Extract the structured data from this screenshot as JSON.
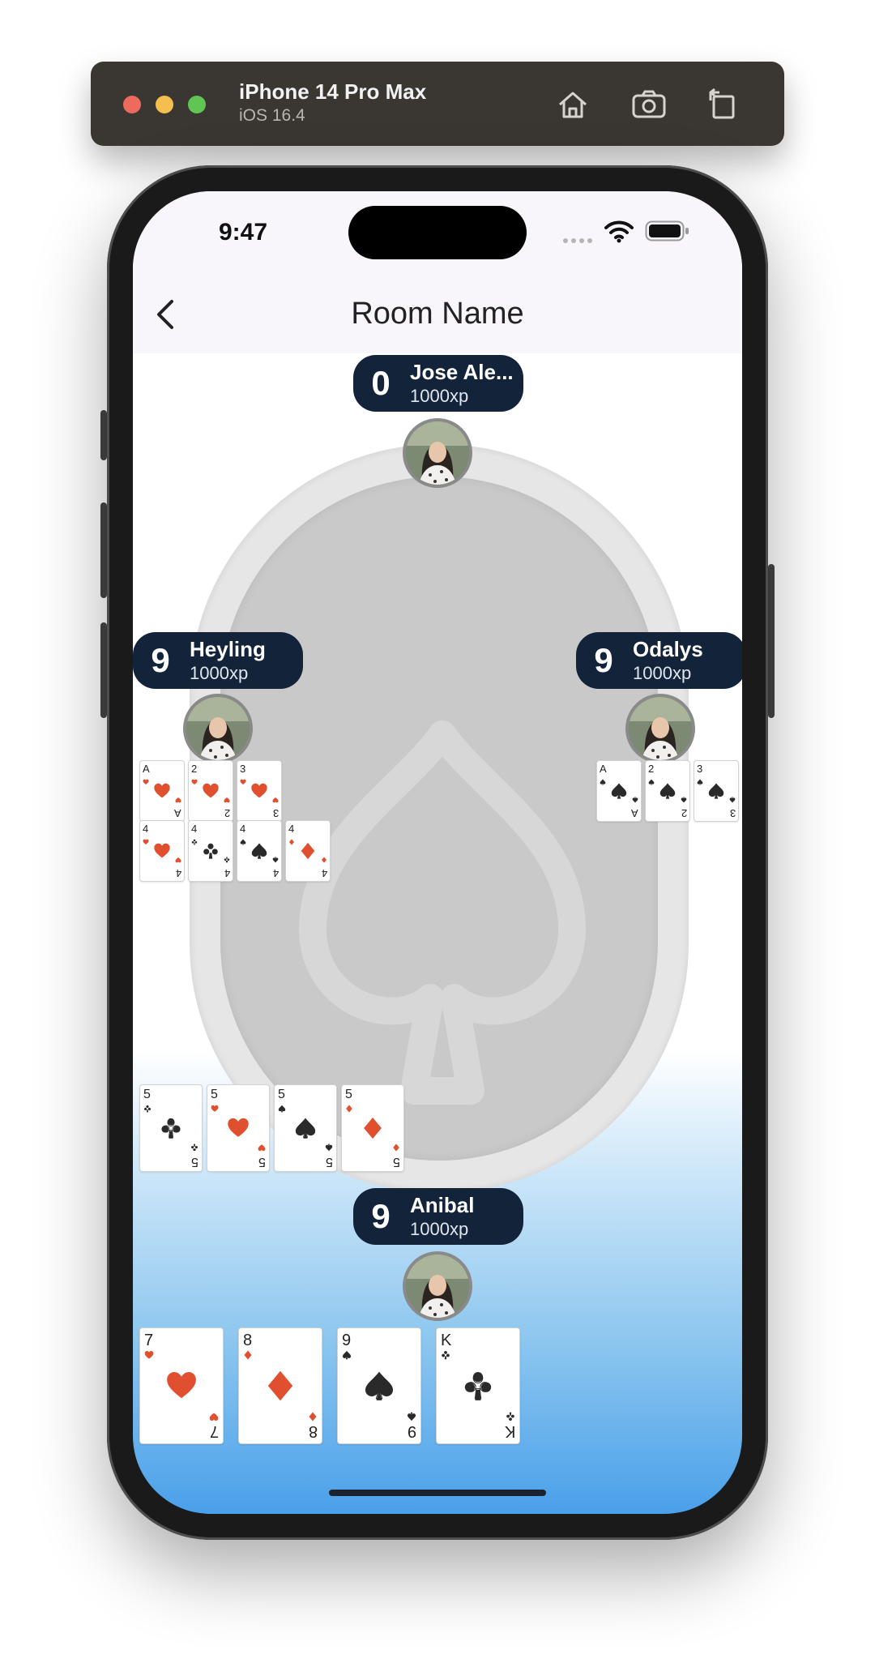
{
  "simulator": {
    "device_name": "iPhone 14 Pro Max",
    "os_version": "iOS 16.4",
    "icons": [
      "home-icon",
      "screenshot-icon",
      "rotate-icon"
    ]
  },
  "status_bar": {
    "time": "9:47",
    "icons": [
      "signal-icon",
      "wifi-icon",
      "battery-icon"
    ]
  },
  "nav": {
    "title": "Room Name",
    "back_icon": "chevron-left-icon"
  },
  "players": {
    "top": {
      "count": "0",
      "name": "Jose Ale...",
      "xp": "1000xp"
    },
    "left": {
      "count": "9",
      "name": "Heyling",
      "xp": "1000xp"
    },
    "right": {
      "count": "9",
      "name": "Odalys",
      "xp": "1000xp"
    },
    "bottom": {
      "count": "9",
      "name": "Anibal",
      "xp": "1000xp"
    }
  },
  "cards": {
    "left_row1": [
      {
        "rank": "A",
        "suit": "hearts"
      },
      {
        "rank": "2",
        "suit": "hearts"
      },
      {
        "rank": "3",
        "suit": "hearts"
      }
    ],
    "left_row2": [
      {
        "rank": "4",
        "suit": "hearts"
      },
      {
        "rank": "4",
        "suit": "clubs"
      },
      {
        "rank": "4",
        "suit": "spades"
      },
      {
        "rank": "4",
        "suit": "diamonds"
      }
    ],
    "right_row": [
      {
        "rank": "A",
        "suit": "spades"
      },
      {
        "rank": "2",
        "suit": "spades"
      },
      {
        "rank": "3",
        "suit": "spades"
      }
    ],
    "played": [
      {
        "rank": "5",
        "suit": "clubs"
      },
      {
        "rank": "5",
        "suit": "hearts"
      },
      {
        "rank": "5",
        "suit": "spades"
      },
      {
        "rank": "5",
        "suit": "diamonds"
      }
    ],
    "hand": [
      {
        "rank": "7",
        "suit": "hearts"
      },
      {
        "rank": "8",
        "suit": "diamonds"
      },
      {
        "rank": "9",
        "suit": "spades"
      },
      {
        "rank": "K",
        "suit": "clubs"
      }
    ]
  },
  "colors": {
    "pill": "#13233a",
    "red_suit": "#e0502e",
    "black_suit": "#2a2a2a",
    "gradient_bottom": "#4aa0ea"
  }
}
